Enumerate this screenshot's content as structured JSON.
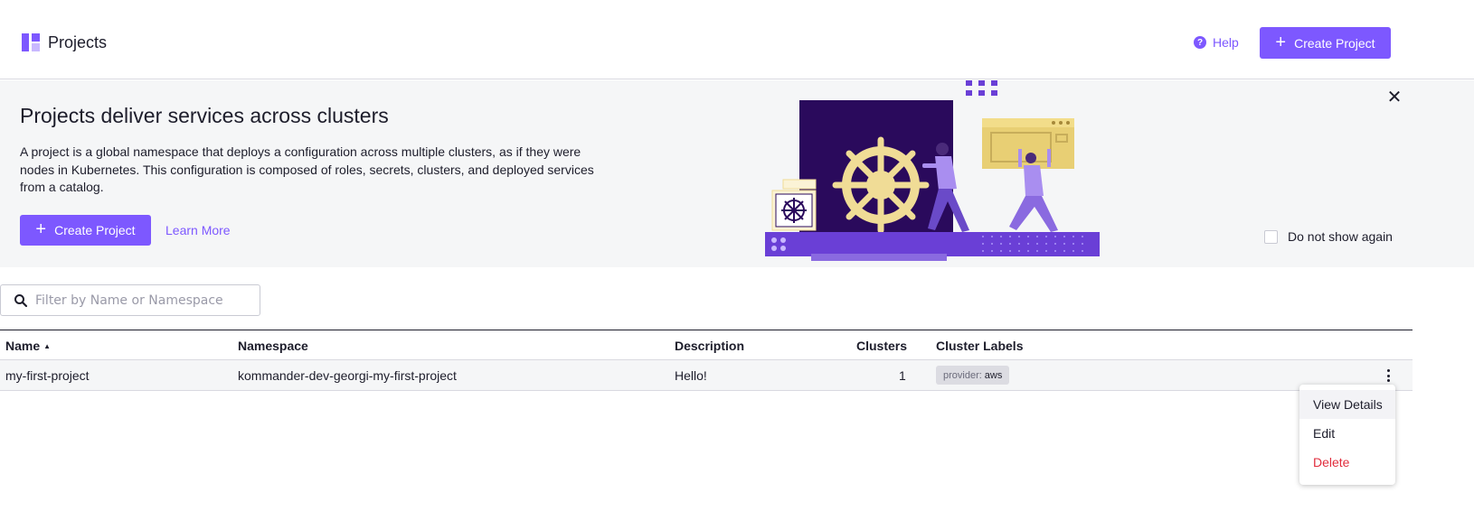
{
  "header": {
    "title": "Projects",
    "help_label": "Help",
    "help_icon": "?",
    "create_label": "Create Project"
  },
  "banner": {
    "title": "Projects deliver services across clusters",
    "description": "A project is a global namespace that deploys a configuration across multiple clusters, as if they were nodes in Kubernetes. This configuration is composed of roles, secrets, clusters, and deployed services from a catalog.",
    "create_label": "Create Project",
    "learn_more_label": "Learn More",
    "dismiss_label": "Do not show again"
  },
  "filter": {
    "placeholder": "Filter by Name or Namespace"
  },
  "table": {
    "headers": {
      "name": "Name",
      "namespace": "Namespace",
      "description": "Description",
      "clusters": "Clusters",
      "cluster_labels": "Cluster Labels"
    },
    "rows": [
      {
        "name": "my-first-project",
        "namespace": "kommander-dev-georgi-my-first-project",
        "description": "Hello!",
        "clusters": "1",
        "label_key": "provider:",
        "label_value": "aws"
      }
    ]
  },
  "menu": {
    "items": [
      "View Details",
      "Edit",
      "Delete"
    ]
  },
  "colors": {
    "accent": "#7d58ff",
    "danger": "#e12d3d",
    "banner_bg": "#f5f6f7",
    "illustration_dark": "#2a0a5c",
    "illustration_yellow": "#f0dc96"
  },
  "icons": {
    "logo": "projects-logo-icon",
    "help": "help-circle-icon",
    "plus": "plus-icon",
    "close": "close-icon",
    "search": "search-icon",
    "kebab": "kebab-menu-icon",
    "sort": "sort-ascending-icon"
  }
}
